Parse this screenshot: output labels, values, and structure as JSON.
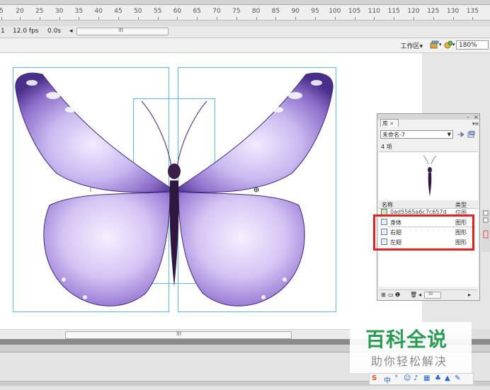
{
  "ruler": {
    "marks": [
      "5",
      "20",
      "25",
      "30",
      "35",
      "40",
      "45",
      "50",
      "55",
      "60",
      "65",
      "70",
      "75",
      "80",
      "85",
      "90",
      "95",
      "100",
      "105",
      "110",
      "115",
      "120",
      "125",
      "130",
      "135"
    ]
  },
  "statusbar": {
    "frame": "1",
    "fps": "12.0 fps",
    "time": "0.0s",
    "scroll_grip": "III"
  },
  "toolbar": {
    "workspace_label": "工作区",
    "workspace_arrow": "▾",
    "zoom_value": "180%"
  },
  "stage": {
    "scroll_grip": "III"
  },
  "library": {
    "window_controls": {
      "minimize": "–",
      "close": "×"
    },
    "tab_label": "库",
    "tab_close": "×",
    "menu_icon": "▾≡",
    "document_name": "未命名-7",
    "item_count": "4 项",
    "headers": {
      "name": "名称",
      "type": "类型"
    },
    "items": [
      {
        "name": "0ad5565a6c7c657d",
        "type": "位图"
      },
      {
        "name": "身体",
        "type": "图形"
      },
      {
        "name": "右翅",
        "type": "图形"
      },
      {
        "name": "左翅",
        "type": "图形"
      }
    ],
    "footer_scroll_grip": "III"
  },
  "watermark": {
    "title": "百科全说",
    "subtitle": "助你轻松解决"
  },
  "ime": {
    "items": [
      "S",
      "中",
      "°",
      "☺",
      "♪",
      "▦",
      "♣",
      "▲",
      "✎"
    ]
  },
  "colors": {
    "bbox": "#5fb6ee",
    "highlight": "#e02222",
    "watermark_green": "#2a9b52"
  }
}
